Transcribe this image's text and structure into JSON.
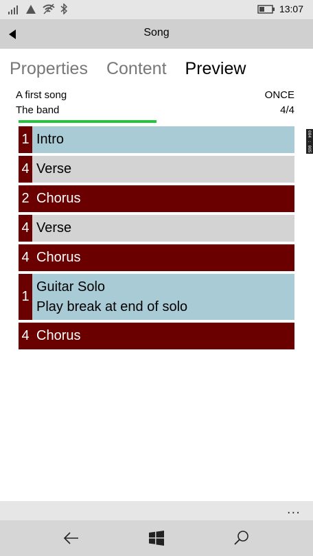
{
  "status": {
    "time": "13:07"
  },
  "header": {
    "title": "Song"
  },
  "tabs": [
    {
      "label": "Properties",
      "active": false
    },
    {
      "label": "Content",
      "active": false
    },
    {
      "label": "Preview",
      "active": true
    }
  ],
  "song": {
    "title": "A first song",
    "artist": "The band",
    "repeat": "ONCE",
    "time_signature": "4/4",
    "progress": 0.5
  },
  "sections": [
    {
      "count": "1",
      "name": "Intro",
      "note": "",
      "kind": "intro"
    },
    {
      "count": "4",
      "name": "Verse",
      "note": "",
      "kind": "verse"
    },
    {
      "count": "2",
      "name": "Chorus",
      "note": "",
      "kind": "chorus"
    },
    {
      "count": "4",
      "name": "Verse",
      "note": "",
      "kind": "verse"
    },
    {
      "count": "4",
      "name": "Chorus",
      "note": "",
      "kind": "chorus"
    },
    {
      "count": "1",
      "name": "Guitar Solo",
      "note": "Play break at end of solo",
      "kind": "solo"
    },
    {
      "count": "4",
      "name": "Chorus",
      "note": "",
      "kind": "chorus"
    }
  ],
  "edge_tag": "004 : 005",
  "appbar": {
    "more_label": "..."
  },
  "colors": {
    "accent_bar": "#22c53e",
    "section_dark": "#6b0000",
    "section_blue": "#a9cbd6",
    "section_grey": "#d3d3d3"
  },
  "icons": {
    "back": "back-arrow-icon",
    "nav_back": "nav-back-icon",
    "nav_home": "windows-logo-icon",
    "nav_search": "search-icon"
  }
}
